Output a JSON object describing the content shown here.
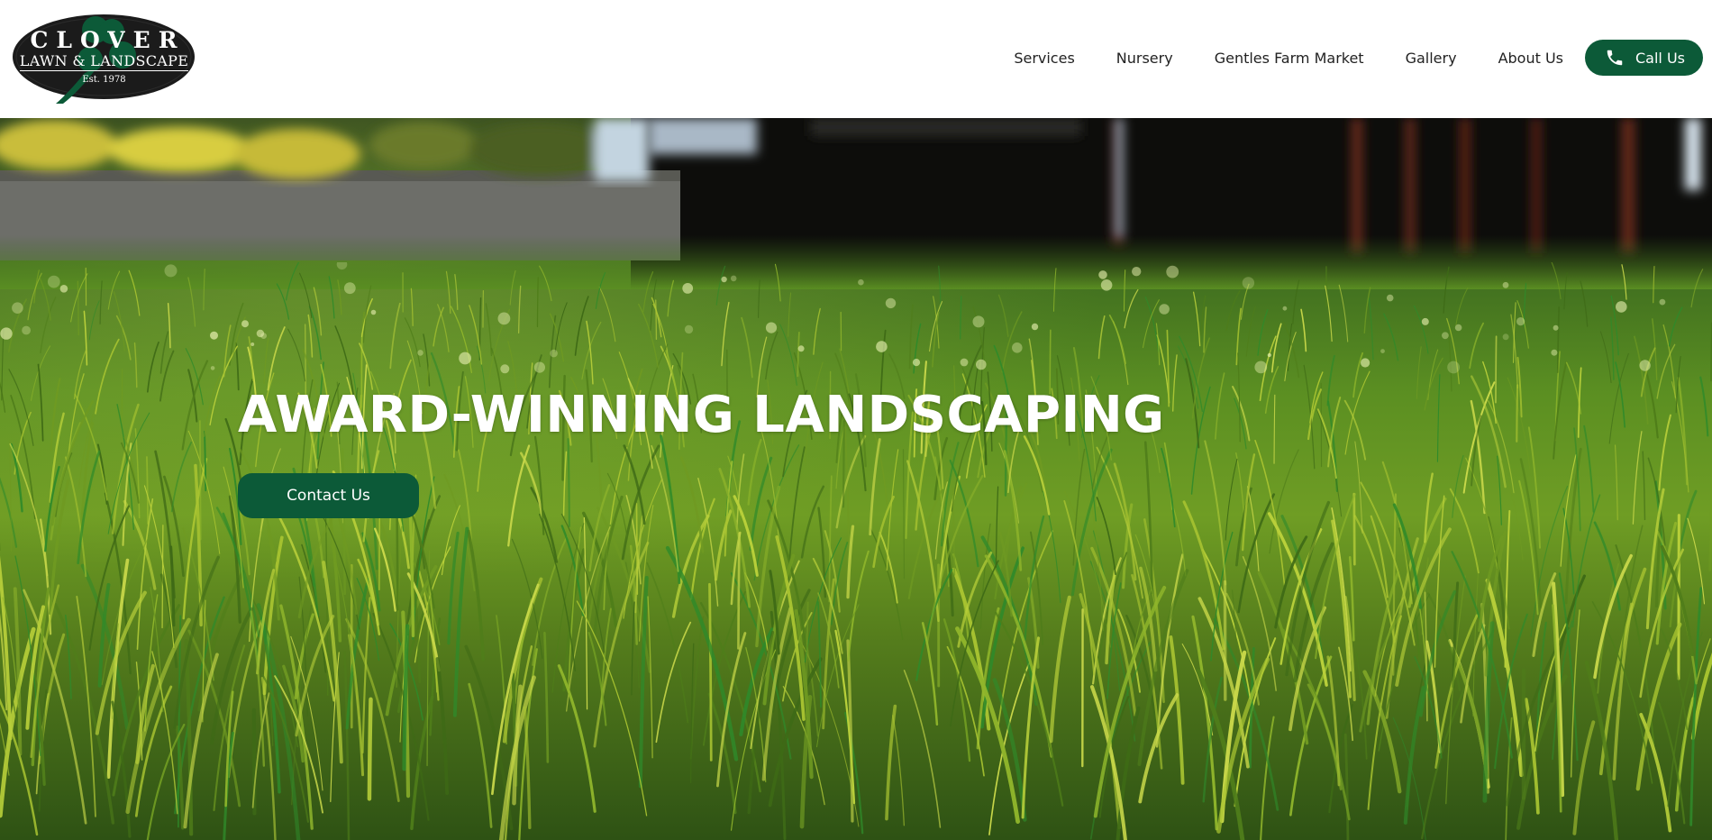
{
  "brand": {
    "line1": "CLOVER",
    "line2": "LAWN & LANDSCAPE",
    "line3": "Est. 1978"
  },
  "nav": {
    "items": [
      {
        "label": "Services"
      },
      {
        "label": "Nursery"
      },
      {
        "label": "Gentles Farm Market"
      },
      {
        "label": "Gallery"
      },
      {
        "label": "About Us"
      }
    ],
    "call_label": "Call Us",
    "call_icon": "phone-icon"
  },
  "hero": {
    "title": "AWARD-WINNING LANDSCAPING",
    "cta_label": "Contact Us"
  },
  "colors": {
    "accent": "#0c5a38",
    "logo_oval": "#1b1b1b",
    "logo_clover": "#0c5a38"
  }
}
